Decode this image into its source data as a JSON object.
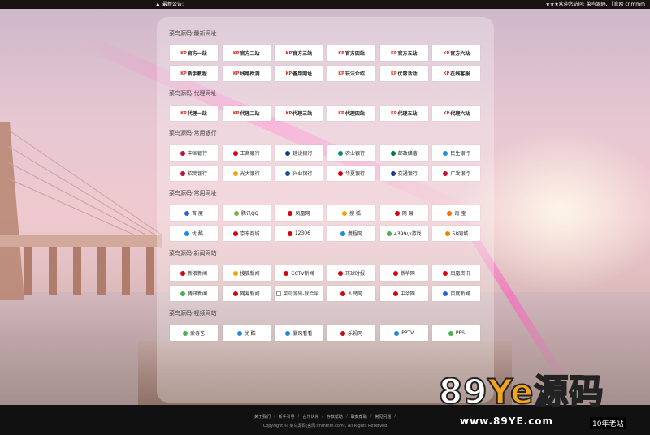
{
  "topbar": {
    "notice_label": "最新公告:",
    "welcome": "★★★欢迎您访问: 菜鸟源码, 【官网 cnmmm"
  },
  "sections": [
    {
      "title": "菜鸟源码-最新网址",
      "style": "kp",
      "items": [
        {
          "label": "官方一站"
        },
        {
          "label": "官方二站"
        },
        {
          "label": "官方三站"
        },
        {
          "label": "官方四站"
        },
        {
          "label": "官方五站"
        },
        {
          "label": "官方六站"
        },
        {
          "label": "新手教程"
        },
        {
          "label": "线路检测"
        },
        {
          "label": "备用网址"
        },
        {
          "label": "玩法介绍"
        },
        {
          "label": "优惠活动"
        },
        {
          "label": "在线客服"
        }
      ]
    },
    {
      "title": "菜鸟源码-代理网址",
      "style": "kp",
      "items": [
        {
          "label": "代理一站"
        },
        {
          "label": "代理二站"
        },
        {
          "label": "代理三站"
        },
        {
          "label": "代理四站"
        },
        {
          "label": "代理五站"
        },
        {
          "label": "代理六站"
        }
      ]
    },
    {
      "title": "菜鸟源码-常用银行",
      "style": "icon",
      "items": [
        {
          "label": "中国银行",
          "icon": "bank-of-china-icon",
          "color": "#c8102e"
        },
        {
          "label": "工商银行",
          "icon": "icbc-icon",
          "color": "#d7000f"
        },
        {
          "label": "建设银行",
          "icon": "ccb-icon",
          "color": "#0a3f8f"
        },
        {
          "label": "农业银行",
          "icon": "abc-icon",
          "color": "#0d8a6f"
        },
        {
          "label": "邮政储蓄",
          "icon": "psbc-icon",
          "color": "#0a7a3a"
        },
        {
          "label": "民生银行",
          "icon": "cmbc-icon",
          "color": "#1f8ec8"
        },
        {
          "label": "招商银行",
          "icon": "cmb-icon",
          "color": "#c8102e"
        },
        {
          "label": "光大银行",
          "icon": "ceb-icon",
          "color": "#f0a500"
        },
        {
          "label": "兴业银行",
          "icon": "cib-icon",
          "color": "#1a4fa0"
        },
        {
          "label": "华夏银行",
          "icon": "hxb-icon",
          "color": "#d7000f"
        },
        {
          "label": "交通银行",
          "icon": "bocom-icon",
          "color": "#1a3d8f"
        },
        {
          "label": "广发银行",
          "icon": "cgb-icon",
          "color": "#c8102e"
        }
      ]
    },
    {
      "title": "菜鸟源码-常用网址",
      "style": "icon",
      "items": [
        {
          "label": "百 度",
          "icon": "baidu-icon",
          "color": "#2b64d8"
        },
        {
          "label": "腾讯QQ",
          "icon": "qq-icon",
          "color": "#7cb342"
        },
        {
          "label": "凤凰网",
          "icon": "ifeng-icon",
          "color": "#d7000f"
        },
        {
          "label": "搜 狐",
          "icon": "sohu-icon",
          "color": "#f0a500"
        },
        {
          "label": "网 易",
          "icon": "netease-icon",
          "color": "#d7000f"
        },
        {
          "label": "淘 宝",
          "icon": "taobao-icon",
          "color": "#ff6a00"
        },
        {
          "label": "优 酷",
          "icon": "youku-icon",
          "color": "#1e88e5"
        },
        {
          "label": "京东商城",
          "icon": "jd-icon",
          "color": "#d7000f"
        },
        {
          "label": "12306",
          "icon": "12306-icon",
          "color": "#d7000f"
        },
        {
          "label": "携程网",
          "icon": "ctrip-icon",
          "color": "#1e88e5"
        },
        {
          "label": "4399小游戏",
          "icon": "4399-icon",
          "color": "#4caf50"
        },
        {
          "label": "58同城",
          "icon": "58-icon",
          "color": "#f57c00"
        }
      ]
    },
    {
      "title": "菜鸟源码-新闻网站",
      "style": "icon",
      "items": [
        {
          "label": "新浪新闻",
          "icon": "sina-icon",
          "color": "#d7000f"
        },
        {
          "label": "搜狐新闻",
          "icon": "sohu-news-icon",
          "color": "#f0a500"
        },
        {
          "label": "CCTV新闻",
          "icon": "cctv-icon",
          "color": "#d7000f"
        },
        {
          "label": "环球时报",
          "icon": "huanqiu-icon",
          "color": "#d7000f"
        },
        {
          "label": "新华网",
          "icon": "xinhua-icon",
          "color": "#d7000f"
        },
        {
          "label": "凤凰资讯",
          "icon": "ifeng-news-icon",
          "color": "#d7000f"
        },
        {
          "label": "腾讯新闻",
          "icon": "tencent-news-icon",
          "color": "#4caf50"
        },
        {
          "label": "网易新闻",
          "icon": "netease-news-icon",
          "color": "#d7000f"
        },
        {
          "label": "菜鸟源码-联合早",
          "icon": "broken-image-icon",
          "color": "#999999",
          "broken": true
        },
        {
          "label": "人民网",
          "icon": "people-icon",
          "color": "#d7000f"
        },
        {
          "label": "中华网",
          "icon": "china-com-icon",
          "color": "#d7000f"
        },
        {
          "label": "百度新闻",
          "icon": "baidu-news-icon",
          "color": "#2b64d8"
        }
      ]
    },
    {
      "title": "菜鸟源码-视频网站",
      "style": "icon",
      "items": [
        {
          "label": "爱奇艺",
          "icon": "iqiyi-icon",
          "color": "#4caf50"
        },
        {
          "label": "优 酷",
          "icon": "youku-icon",
          "color": "#1e88e5"
        },
        {
          "label": "暴风看看",
          "icon": "baofeng-icon",
          "color": "#1e88e5"
        },
        {
          "label": "乐视网",
          "icon": "letv-icon",
          "color": "#d7000f"
        },
        {
          "label": "PPTV",
          "icon": "pptv-icon",
          "color": "#1e88e5"
        },
        {
          "label": "PPS",
          "icon": "pps-icon",
          "color": "#4caf50"
        }
      ]
    }
  ],
  "footer": {
    "links": [
      "关于我们",
      "新手引导",
      "合作伙伴",
      "存款帮助",
      "取款帮助",
      "常见问题"
    ],
    "copyright": "Copyright © 菜鸟源码(官网:cnmmm.com), All Rights Reserved"
  },
  "watermark": {
    "logo_text": "89Ye源码",
    "url": "www.89YE.com",
    "badge": "10年老站"
  }
}
